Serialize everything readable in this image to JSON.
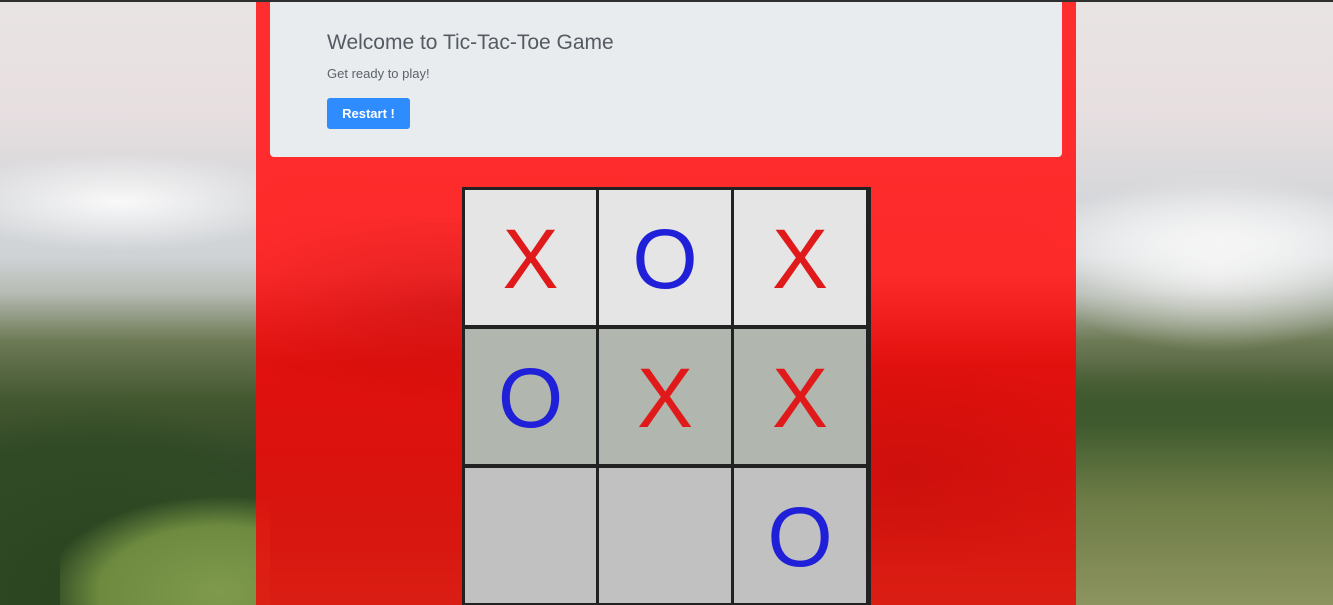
{
  "header": {
    "title": "Welcome to Tic-Tac-Toe Game",
    "subtitle": "Get ready to play!",
    "restart_label": "Restart !"
  },
  "board": {
    "cells": [
      "X",
      "O",
      "X",
      "O",
      "X",
      "X",
      "",
      "",
      "O"
    ]
  },
  "colors": {
    "x_mark": "#e01a1a",
    "o_mark": "#2020d8",
    "panel": "#ff2828",
    "button": "#2f8cff"
  }
}
